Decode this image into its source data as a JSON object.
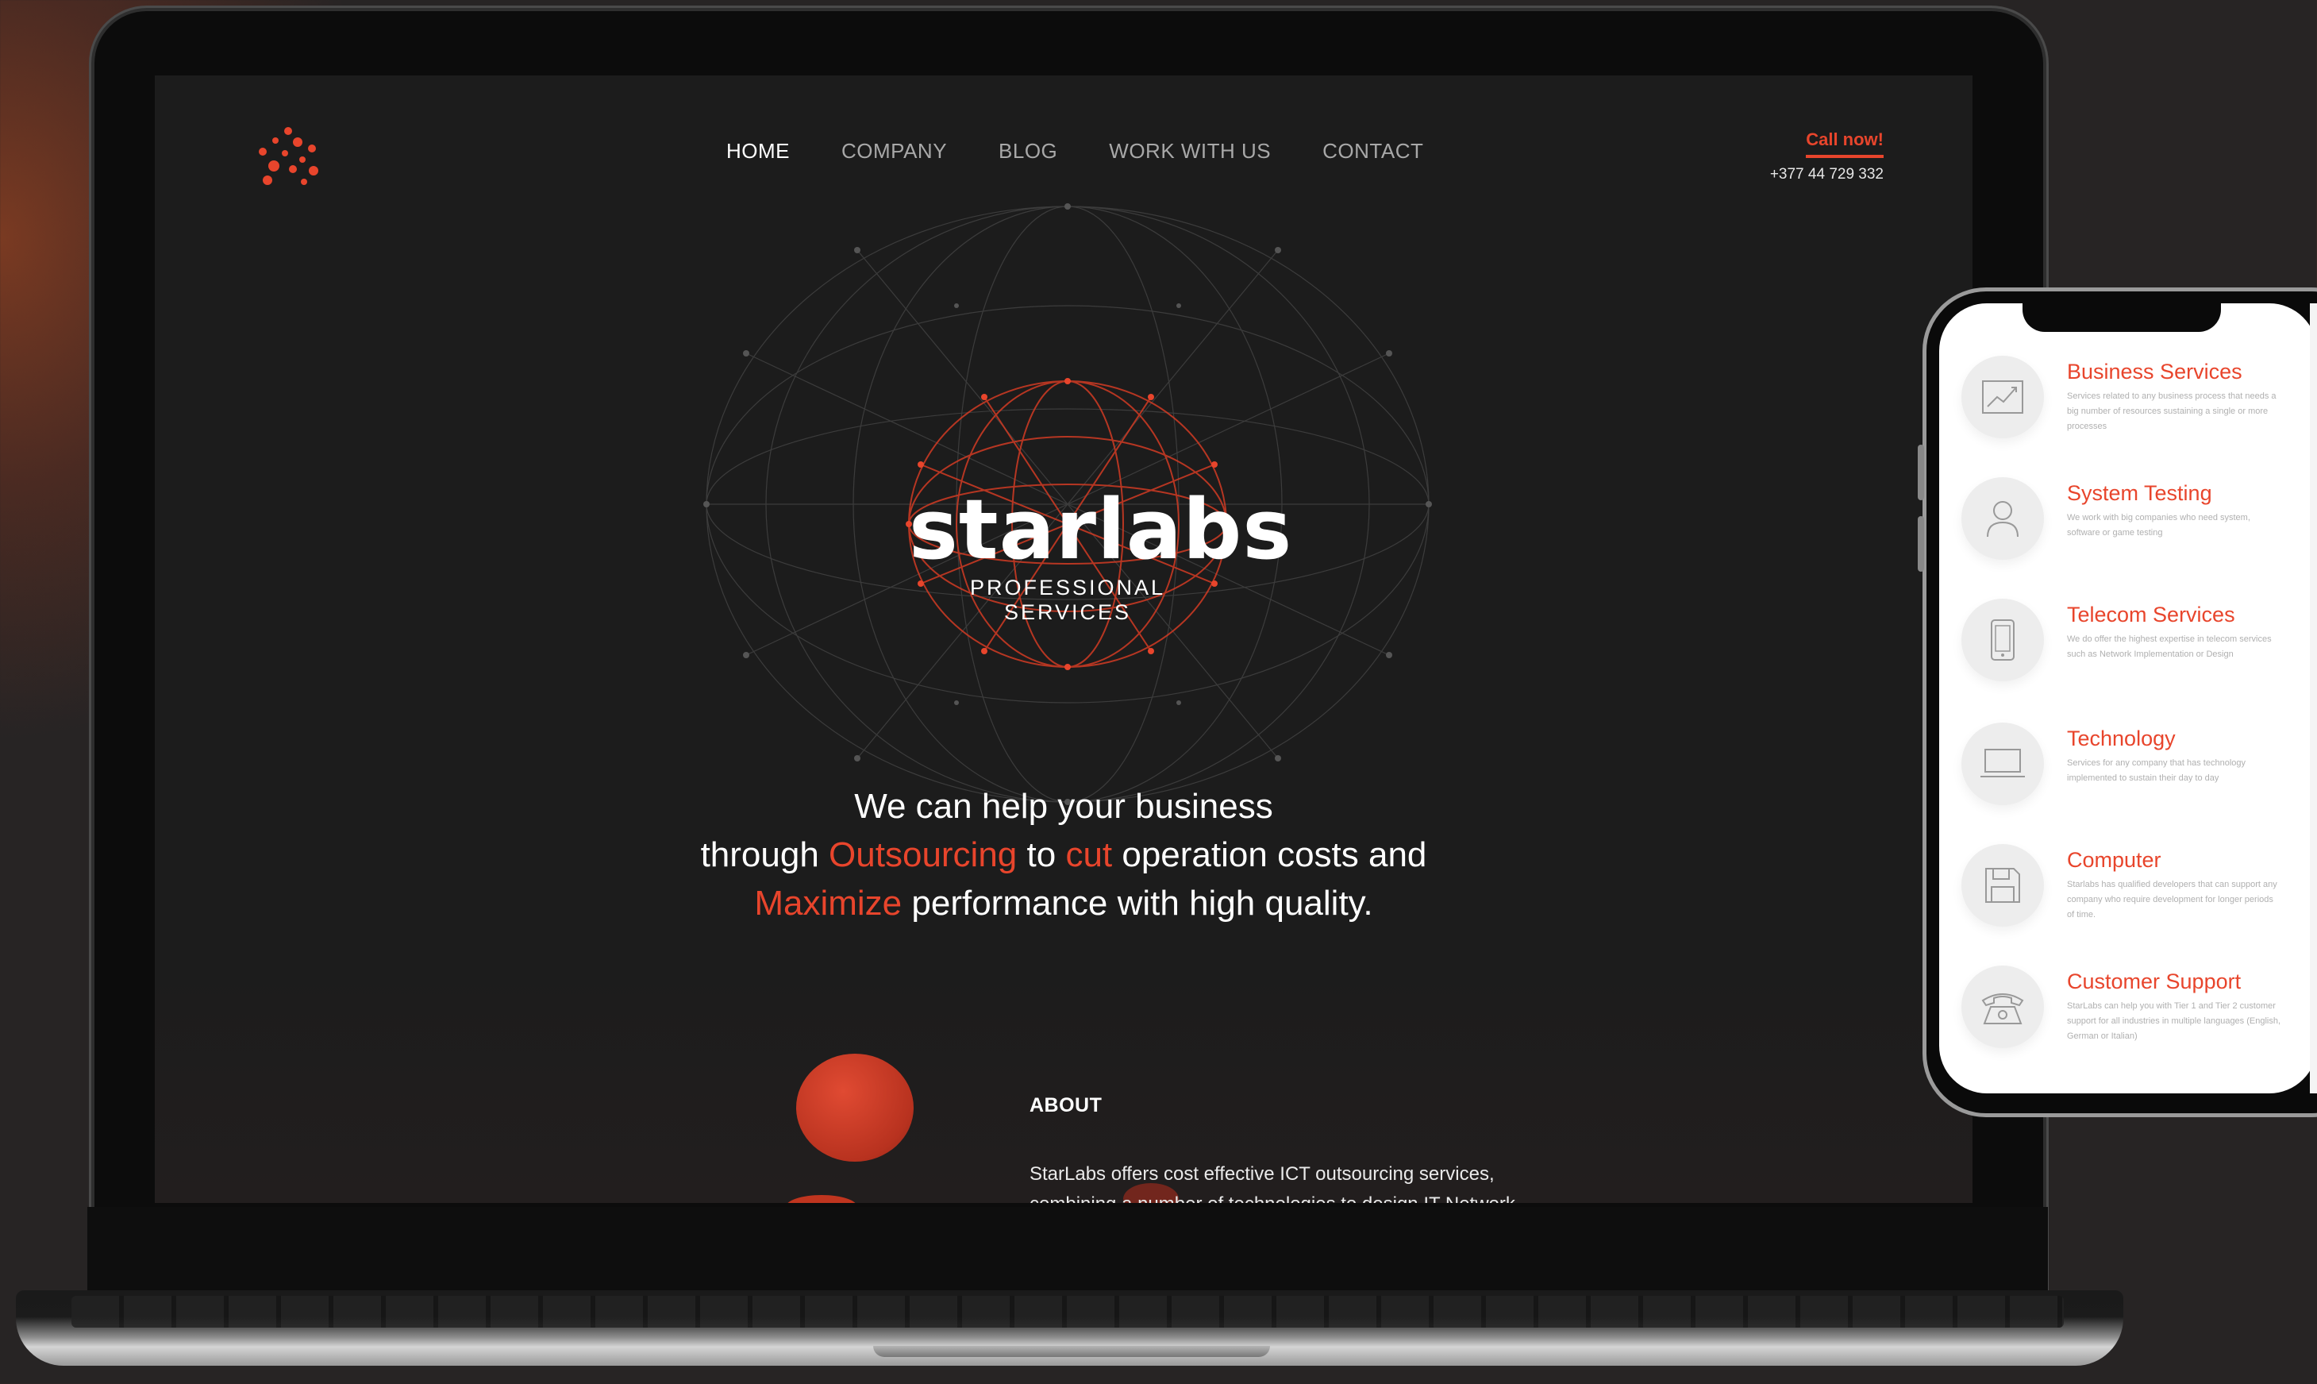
{
  "site": {
    "nav": {
      "home": "HOME",
      "company": "COMPANY",
      "blog": "BLOG",
      "work": "WORK WITH US",
      "contact": "CONTACT"
    },
    "call": {
      "label": "Call now!",
      "phone": "+377 44 729 332"
    },
    "brand": {
      "name": "starlabs",
      "subtitle": "PROFESSIONAL SERVICES"
    },
    "tagline": {
      "line1": "We can help your business",
      "line2_a": "through ",
      "line2_hl1": "Outsourcing",
      "line2_b": " to ",
      "line2_hl2": "cut",
      "line2_c": " operation costs and",
      "line3_hl": "Maximize",
      "line3_a": " performance with high quality."
    },
    "about": {
      "title": "ABOUT",
      "line1": "StarLabs offers cost effective ICT outsourcing services,",
      "line2": "combining a number of technologies to design IT Network"
    }
  },
  "phone": {
    "services": [
      {
        "title": "Business Services",
        "desc": "Services related to any business process that needs a big number of resources sustaining a single or more processes",
        "icon": "chart-icon"
      },
      {
        "title": "System Testing",
        "desc": "We work with big companies who need system, software or game testing",
        "icon": "user-icon"
      },
      {
        "title": "Telecom Services",
        "desc": "We do offer the highest expertise in telecom services such as Network Implementation or Design",
        "icon": "mobile-icon"
      },
      {
        "title": "Technology",
        "desc": "Services for any company that has technology implemented to sustain their day to day",
        "icon": "laptop-icon"
      },
      {
        "title": "Computer",
        "desc": "Starlabs has qualified developers that can support any company who require development for longer periods of time.",
        "icon": "floppy-icon"
      },
      {
        "title": "Customer Support",
        "desc": "StarLabs can help you with Tier 1 and Tier 2 customer support for all industries in multiple languages (English, German or Italian)",
        "icon": "telephone-icon"
      }
    ]
  },
  "colors": {
    "accent": "#e8452c",
    "background": "#1c1c1c"
  }
}
